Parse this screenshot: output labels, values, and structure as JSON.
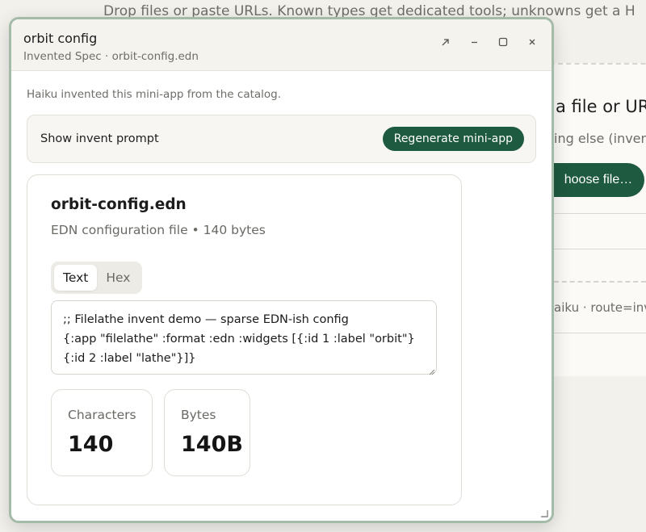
{
  "background": {
    "hint": "Drop files or paste URLs. Known types get dedicated tools; unknowns get a H",
    "drop_title": "a file or URL",
    "drop_sub": "ing else (invent",
    "choose_button": "hoose file…",
    "route_text": "aiku · route=inv"
  },
  "window": {
    "title": "orbit config",
    "subtitle": "Invented Spec · orbit-config.edn",
    "controls": [
      "expand-icon",
      "minimize-icon",
      "maximize-icon",
      "close-icon"
    ],
    "note": "Haiku invented this mini-app from the catalog.",
    "prompt_toggle": "Show invent prompt",
    "regen_button": "Regenerate mini-app"
  },
  "file": {
    "name": "orbit-config.edn",
    "meta": "EDN configuration file • 140 bytes",
    "tabs": [
      {
        "label": "Text",
        "active": true
      },
      {
        "label": "Hex",
        "active": false
      }
    ],
    "content": ";; Filelathe invent demo — sparse EDN-ish config\n{:app \"filelathe\" :format :edn :widgets [{:id 1 :label \"orbit\"} {:id 2 :label \"lathe\"}]}",
    "stats": [
      {
        "label": "Characters",
        "value": "140"
      },
      {
        "label": "Bytes",
        "value": "140B"
      }
    ]
  },
  "colors": {
    "accent": "#1e5a3f",
    "window_border": "#a5bba9",
    "background": "#f3f1ec"
  }
}
